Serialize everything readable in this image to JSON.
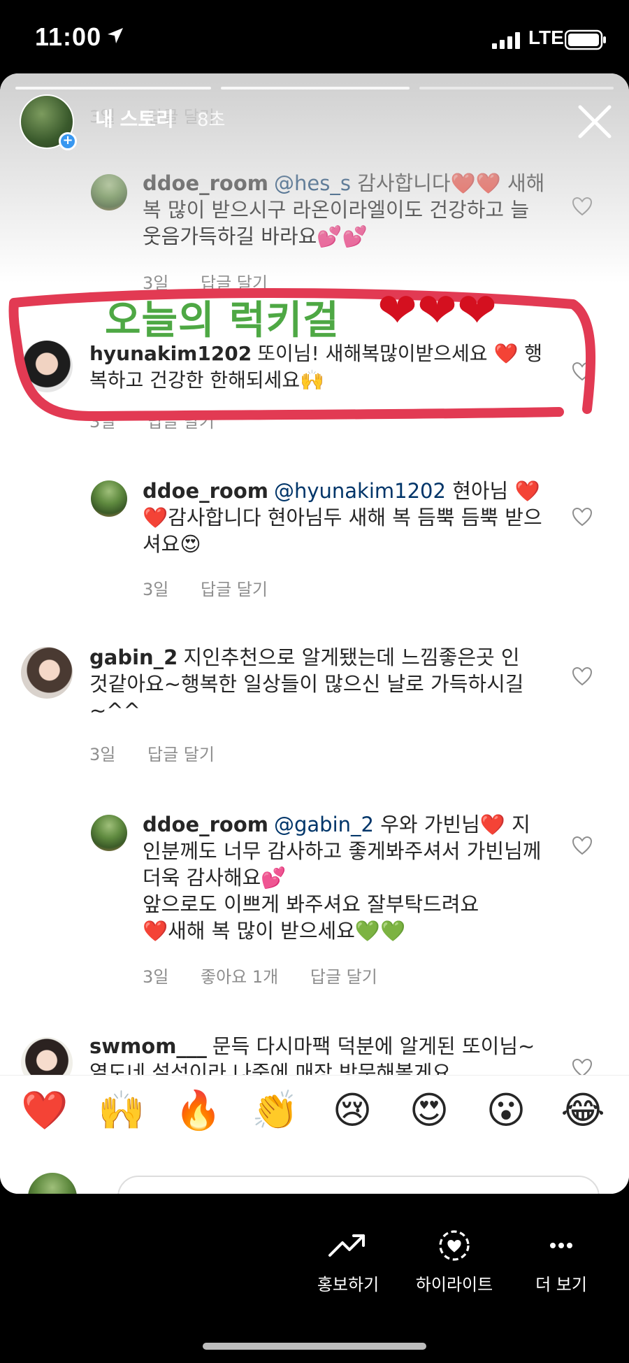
{
  "status_bar": {
    "time": "11:00",
    "carrier": "LTE"
  },
  "story": {
    "owner_label": "내 스토리",
    "elapsed": "8초"
  },
  "comments": [
    {
      "username": "",
      "text": "",
      "age": "3일",
      "reply_label": "답글 달기"
    },
    {
      "username": "ddoe_room",
      "mention": "@hes_s",
      "text": "감사합니다",
      "text2": "새해 복 많이 받으시구 라온이라엘이도 건강하고 늘 웃음가득하길 바라요",
      "age": "3일",
      "reply_label": "답글 달기"
    },
    {
      "username": "hyunakim1202",
      "text": "또이님! 새해복많이받으세요",
      "text2": "행복하고 건강한 한해되세요",
      "age": "3일",
      "reply_label": "답글 달기"
    },
    {
      "username": "ddoe_room",
      "mention": "@hyunakim1202",
      "text": "현아님",
      "text2": "감사합니다 현아님두 새해 복 듬뿍 듬뿍 받으셔요",
      "age": "3일",
      "reply_label": "답글 달기"
    },
    {
      "username": "gabin_2",
      "text": "지인추천으로 알게됐는데 느낌좋은곳 인것같아요~행복한 일상들이 많으신 날로 가득하시길~^^",
      "age": "3일",
      "reply_label": "답글 달기"
    },
    {
      "username": "ddoe_room",
      "mention": "@gabin_2",
      "text": "우와 가빈님",
      "text2": "지인분께도 너무 감사하고 좋게봐주셔서 가빈님께 더욱 감사해요",
      "text3": "앞으로도 이쁘게 봐주셔요 잘부탁드려요",
      "text4": "새해 복 많이 받으세요",
      "age": "3일",
      "likes": "좋아요 1개",
      "reply_label": "답글 달기"
    },
    {
      "username": "swmom___",
      "text": "문득 다시마팩 덕분에 알게된 또이님~ 열도네 설석이라 나중에 매장 방문해볼게요",
      "age": "",
      "reply_label": ""
    }
  ],
  "annotation": {
    "text": "오늘의 럭키걸",
    "hearts": "❤❤❤"
  },
  "emoji_reactions": [
    "❤️",
    "🙌",
    "🔥",
    "👏",
    "😢",
    "😍",
    "😮",
    "😂"
  ],
  "actions": [
    {
      "label": "홍보하기",
      "icon": "trending-up-icon"
    },
    {
      "label": "하이라이트",
      "icon": "highlight-heart-icon"
    },
    {
      "label": "더 보기",
      "icon": "more-dots-icon"
    }
  ]
}
